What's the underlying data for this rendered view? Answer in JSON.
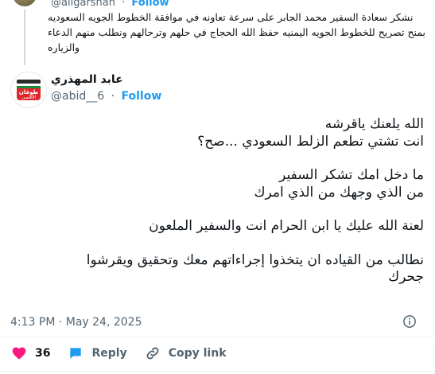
{
  "parent_tweet": {
    "handle": "@aligarshah",
    "follow_label": "Follow",
    "text": "نشكر سعادة السفير محمد الجابر على سرعة تعاونه في موافقة الخطوط الجويه السعوديه بمنح تصريح للخطوط الجويه اليمنيه حفظ الله الحجاج في حلهم وترحالهم ونطلب منهم الدعاء والزياره"
  },
  "tweet": {
    "display_name": "عابد المهذري",
    "handle": "@abid__6",
    "separator": "·",
    "follow_label": "Follow",
    "body_lines": [
      "الله يلعنك ياقرشه",
      "انت تشتي تطعم الزلط السعودي ...صح؟",
      "",
      "ما دخل امك تشكر السفير",
      "من الذي وجهك من الذي امرك",
      "",
      "لعنة الله عليك يا ابن الحرام انت والسفير الملعون",
      "",
      "نطالب من  القياده ان يتخذوا إجراءاتهم معك وتحقيق ويقرشوا",
      "جحرك"
    ],
    "timestamp": "4:13 PM · May 24, 2025"
  },
  "avatar_badge": {
    "line1": "طوفان",
    "line2": "الأقصى"
  },
  "actions": {
    "like_count": "36",
    "reply_label": "Reply",
    "copy_link_label": "Copy link"
  },
  "colors": {
    "accent": "#1d9bf0",
    "like": "#f91880",
    "text": "#0f1419",
    "secondary": "#536471",
    "avatar_red": "#e0242b"
  },
  "icons": {
    "like": "heart-icon",
    "reply": "reply-bubble-icon",
    "copy_link": "link-icon",
    "info": "info-icon"
  }
}
